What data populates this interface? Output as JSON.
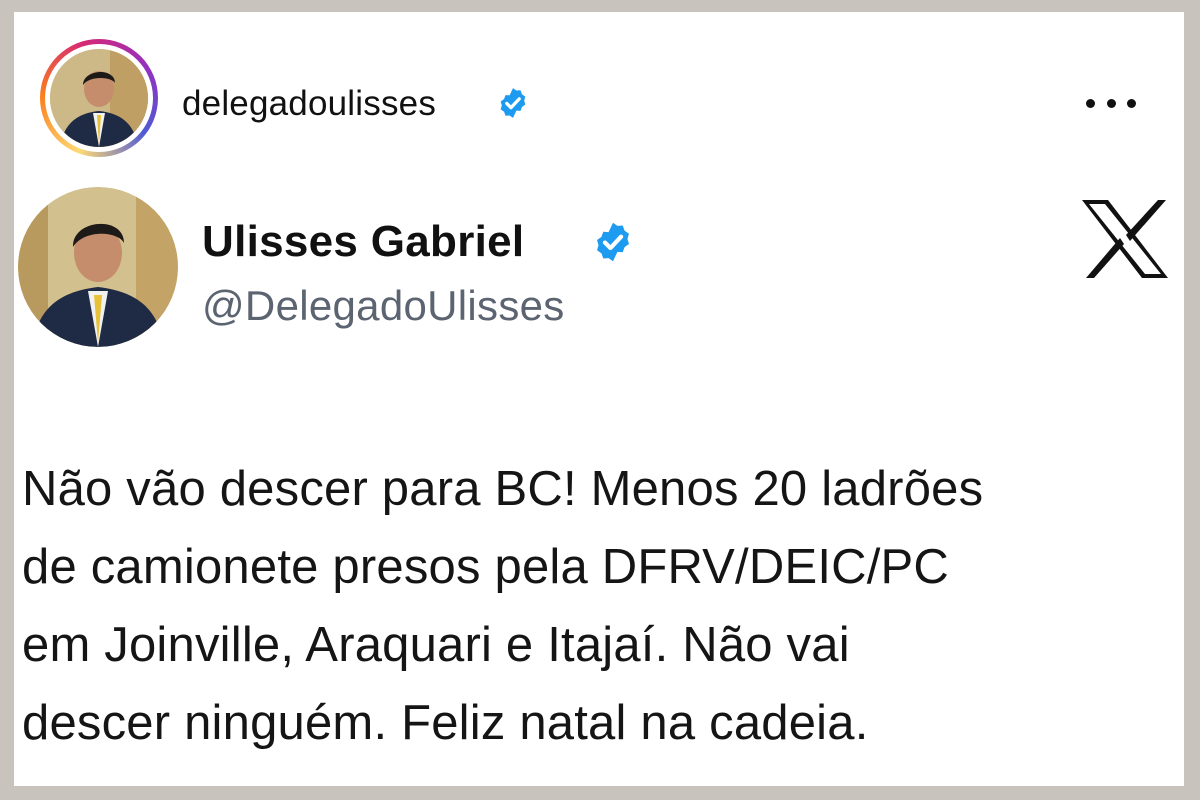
{
  "instagram": {
    "username": "delegadoulisses",
    "verified_icon": "verified-badge-icon",
    "more_icon": "more-options-icon"
  },
  "tweet": {
    "display_name": "Ulisses Gabriel",
    "handle": "@DelegadoUlisses",
    "platform_icon": "x-logo-icon",
    "lines": [
      "Não vão descer para BC! Menos 20 ladrões",
      "de camionete presos pela DFRV/DEIC/PC",
      "em Joinville, Araquari e Itajaí. Não vai",
      "descer ninguém. Feliz natal na cadeia."
    ]
  },
  "colors": {
    "verified_blue": "#1d9bf0",
    "text": "#111111",
    "handle_gray": "#5b6470",
    "background_frame": "#c9c3bd"
  }
}
